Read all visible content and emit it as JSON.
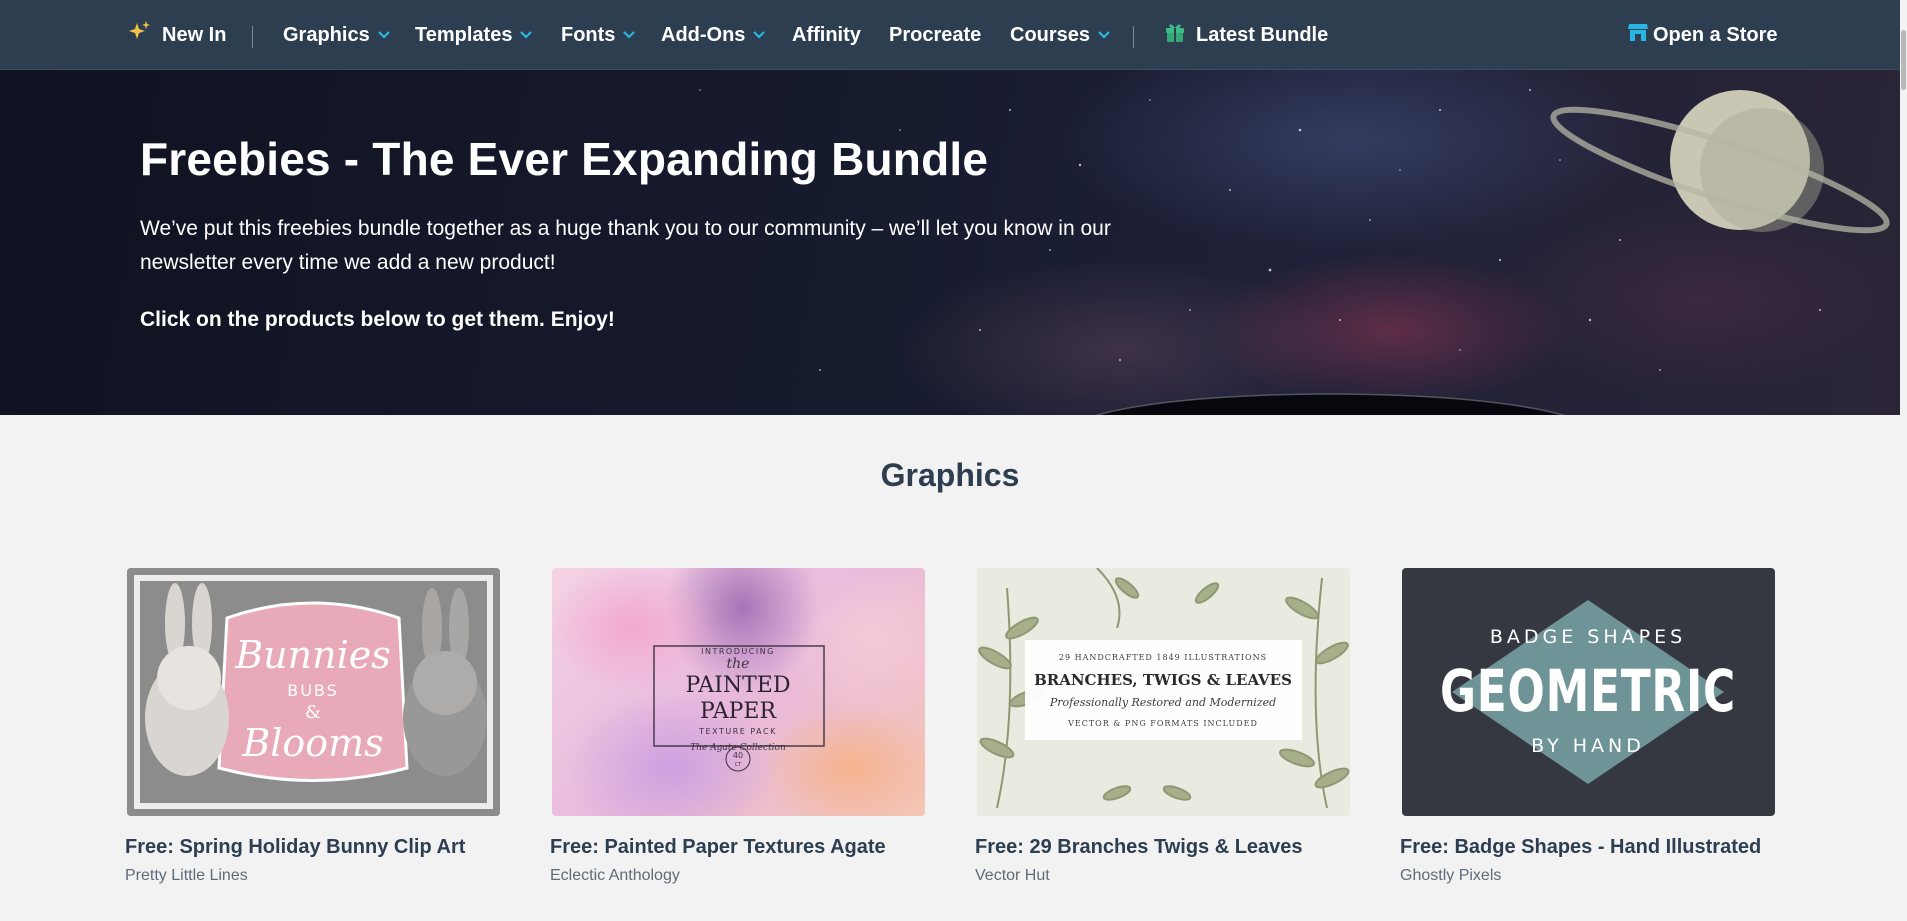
{
  "nav": {
    "new_in": "New In",
    "graphics": "Graphics",
    "templates": "Templates",
    "fonts": "Fonts",
    "addons": "Add-Ons",
    "affinity": "Affinity",
    "procreate": "Procreate",
    "courses": "Courses",
    "latest_bundle": "Latest Bundle",
    "open_store": "Open a Store",
    "accent_color": "#27b6e3"
  },
  "hero": {
    "title": "Freebies - The Ever Expanding Bundle",
    "description": "We’ve put this freebies bundle together as a huge thank you to our community – we’ll let you know in our newsletter every time we add a new product!",
    "cta": "Click on the products below to get them. Enjoy!"
  },
  "section": {
    "title": "Graphics"
  },
  "cards": [
    {
      "name": "Free: Spring Holiday Bunny Clip Art",
      "author": "Pretty Little Lines",
      "thumb_text": {
        "line1": "Bunnies",
        "line2": "BUBS",
        "line3": "&",
        "line4": "Blooms"
      }
    },
    {
      "name": "Free: Painted Paper Textures Agate",
      "author": "Eclectic Anthology",
      "thumb_text": {
        "intro": "INTRODUCING",
        "the": "the",
        "line1": "PAINTED",
        "line2": "PAPER",
        "line3": "TEXTURE PACK",
        "line4": "The Agate Collection",
        "badge": "40",
        "badge_sub": "CT"
      }
    },
    {
      "name": "Free: 29 Branches Twigs & Leaves",
      "author": "Vector Hut",
      "thumb_text": {
        "line1": "29 HANDCRAFTED 1849 ILLUSTRATIONS",
        "line2": "BRANCHES, TWIGS & LEAVES",
        "line3": "Professionally Restored and Modernized",
        "line4": "VECTOR & PNG FORMATS INCLUDED"
      }
    },
    {
      "name": "Free: Badge Shapes - Hand Illustrated",
      "author": "Ghostly Pixels",
      "thumb_text": {
        "line1": "BADGE SHAPES",
        "line2": "GEOMETRIC",
        "line3": "BY HAND"
      }
    }
  ]
}
